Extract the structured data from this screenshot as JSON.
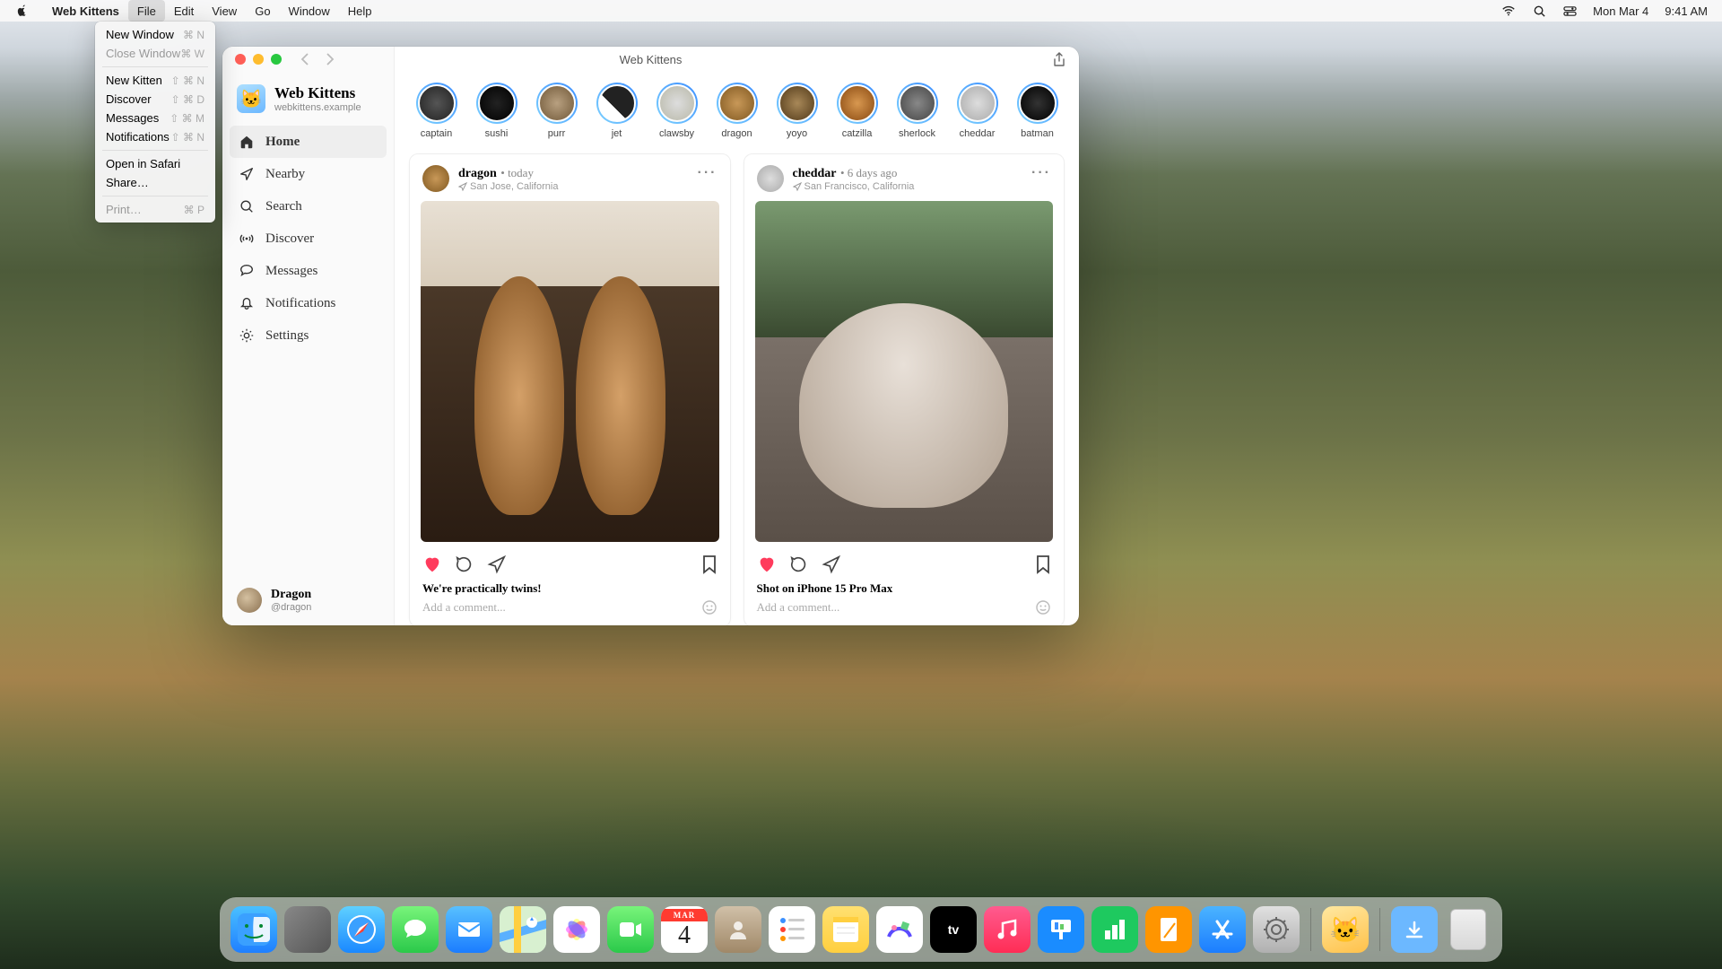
{
  "menubar": {
    "appName": "Web Kittens",
    "items": [
      "File",
      "Edit",
      "View",
      "Go",
      "Window",
      "Help"
    ],
    "date": "Mon Mar 4",
    "time": "9:41 AM"
  },
  "fileMenu": {
    "newWindow": "New Window",
    "newWindowKey": "⌘ N",
    "closeWindow": "Close Window",
    "closeWindowKey": "⌘ W",
    "newKitten": "New Kitten",
    "newKittenKey": "⇧ ⌘ N",
    "discover": "Discover",
    "discoverKey": "⇧ ⌘ D",
    "messages": "Messages",
    "messagesKey": "⇧ ⌘ M",
    "notifications": "Notifications",
    "notificationsKey": "⇧ ⌘ N",
    "openSafari": "Open in Safari",
    "share": "Share…",
    "print": "Print…",
    "printKey": "⌘ P"
  },
  "window": {
    "title": "Web Kittens"
  },
  "app": {
    "name": "Web Kittens",
    "subtitle": "webkittens.example",
    "iconEmoji": "🐱"
  },
  "nav": {
    "home": "Home",
    "nearby": "Nearby",
    "search": "Search",
    "discover": "Discover",
    "messages": "Messages",
    "notifications": "Notifications",
    "settings": "Settings"
  },
  "user": {
    "name": "Dragon",
    "handle": "@dragon"
  },
  "stories": [
    {
      "name": "captain"
    },
    {
      "name": "sushi"
    },
    {
      "name": "purr"
    },
    {
      "name": "jet"
    },
    {
      "name": "clawsby"
    },
    {
      "name": "dragon"
    },
    {
      "name": "yoyo"
    },
    {
      "name": "catzilla"
    },
    {
      "name": "sherlock"
    },
    {
      "name": "cheddar"
    },
    {
      "name": "batman"
    }
  ],
  "posts": [
    {
      "author": "dragon",
      "time": "today",
      "location": "San Jose, California",
      "caption": "We're practically twins!",
      "commentPlaceholder": "Add a comment..."
    },
    {
      "author": "cheddar",
      "time": "6 days ago",
      "location": "San Francisco, California",
      "caption": "Shot on iPhone 15 Pro Max",
      "commentPlaceholder": "Add a comment..."
    }
  ],
  "calendar": {
    "month": "MAR",
    "day": "4"
  },
  "dockApp": {
    "emoji": "🐱"
  }
}
